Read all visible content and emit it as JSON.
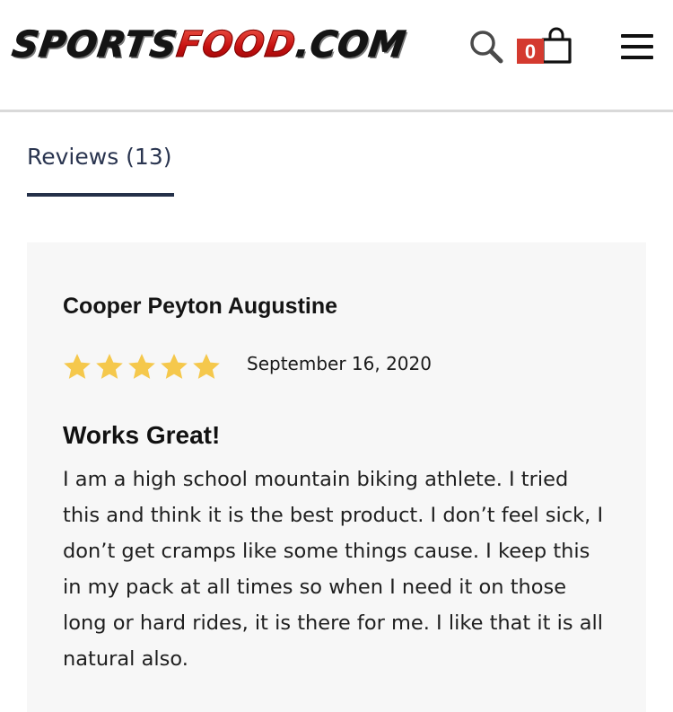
{
  "header": {
    "logo": {
      "part1": "SPORTS",
      "part2": "FOOD",
      "part3": ".COM"
    },
    "search_icon": "search-icon",
    "cart": {
      "icon": "shopping-bag-icon",
      "count": "0",
      "badge_color": "#d43a2f"
    },
    "menu_icon": "hamburger-menu-icon"
  },
  "tabs": [
    {
      "label": "Reviews (13)",
      "active": true
    }
  ],
  "review": {
    "author": "Cooper Peyton Augustine",
    "rating": 5,
    "rating_max": 5,
    "star_color": "#f5c84c",
    "date": "September 16, 2020",
    "title": "Works Great!",
    "body_lines": [
      "I am a high school mountain biking athlete. I tried",
      "this and think it is the best product. I don’t feel sick, I",
      "don’t get cramps like some things cause. I keep this",
      "in my pack at all times so when I need it on those",
      "long or hard rides, it is there for me. I like that it is all",
      "natural also."
    ]
  },
  "colors": {
    "tab_text": "#2a3550",
    "card_background": "#f7f7f7",
    "logo_red": "#d01717"
  }
}
